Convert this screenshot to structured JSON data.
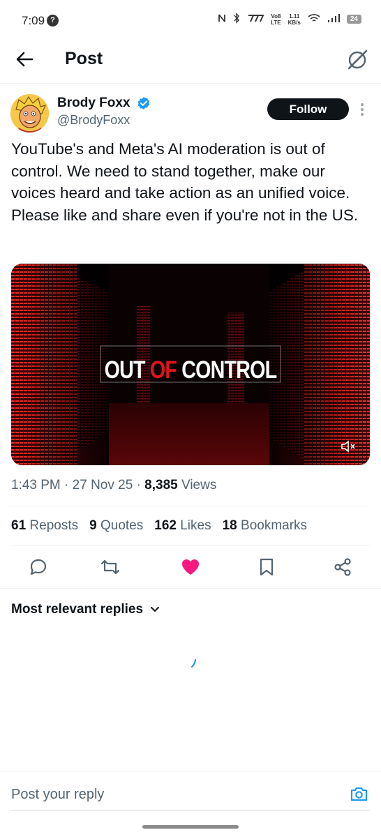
{
  "status_bar": {
    "time": "7:09",
    "notification_badge": "?",
    "volte": "Vo8",
    "lte": "LTE",
    "net_speed_value": "1.11",
    "net_speed_unit": "KB/s",
    "battery": "24",
    "icons": [
      "nfc-icon",
      "bluetooth-icon",
      "carrier-icon",
      "wifi-icon",
      "signal-icon",
      "battery-icon"
    ]
  },
  "header": {
    "title": "Post"
  },
  "author": {
    "name": "Brody Foxx",
    "handle": "@BrodyFoxx",
    "verified": true,
    "follow_label": "Follow"
  },
  "tweet": {
    "text": "YouTube's and Meta's AI moderation is out of control. We need to stand together, make our voices heard and take action as an unified voice. Please like and share even if you're not in the US.",
    "media": {
      "title_part1": "OUT ",
      "title_part2": "OF",
      "title_part3": " CONTROL",
      "muted": true
    },
    "time": "1:43 PM",
    "date": "27 Nov 25",
    "views_count": "8,385",
    "views_label": "Views"
  },
  "stats": {
    "reposts_count": "61",
    "reposts_label": "Reposts",
    "quotes_count": "9",
    "quotes_label": "Quotes",
    "likes_count": "162",
    "likes_label": "Likes",
    "bookmarks_count": "18",
    "bookmarks_label": "Bookmarks"
  },
  "colors": {
    "like_active": "#f91880",
    "accent": "#1d9bf0",
    "text_secondary": "#536471"
  },
  "replies": {
    "sort_label": "Most relevant replies"
  },
  "composer": {
    "placeholder": "Post your reply"
  }
}
